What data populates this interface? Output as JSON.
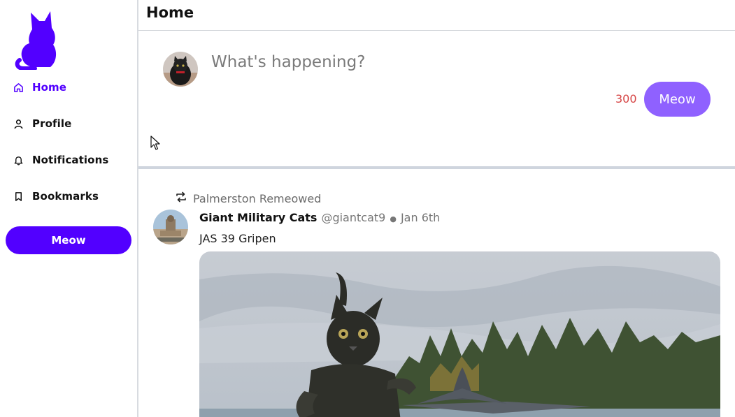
{
  "sidebar": {
    "items": [
      {
        "label": "Home",
        "icon": "home-icon",
        "active": true
      },
      {
        "label": "Profile",
        "icon": "user-icon",
        "active": false
      },
      {
        "label": "Notifications",
        "icon": "bell-icon",
        "active": false
      },
      {
        "label": "Bookmarks",
        "icon": "bookmark-icon",
        "active": false
      }
    ],
    "meow_button": "Meow"
  },
  "header": {
    "title": "Home"
  },
  "composer": {
    "placeholder": "What's happening?",
    "value": "",
    "counter": "300",
    "submit_label": "Meow"
  },
  "feed": {
    "posts": [
      {
        "reposted_by": "Palmerston Remeowed",
        "author_name": "Giant Military Cats",
        "handle": "@giantcat9",
        "separator": "●",
        "date": "Jan 6th",
        "text": "JAS 39 Gripen"
      }
    ]
  },
  "colors": {
    "brand": "#5200ff",
    "composer_button": "#8f61ff",
    "counter": "#d64545",
    "muted_text": "#777777",
    "divider": "#cfd5de"
  }
}
